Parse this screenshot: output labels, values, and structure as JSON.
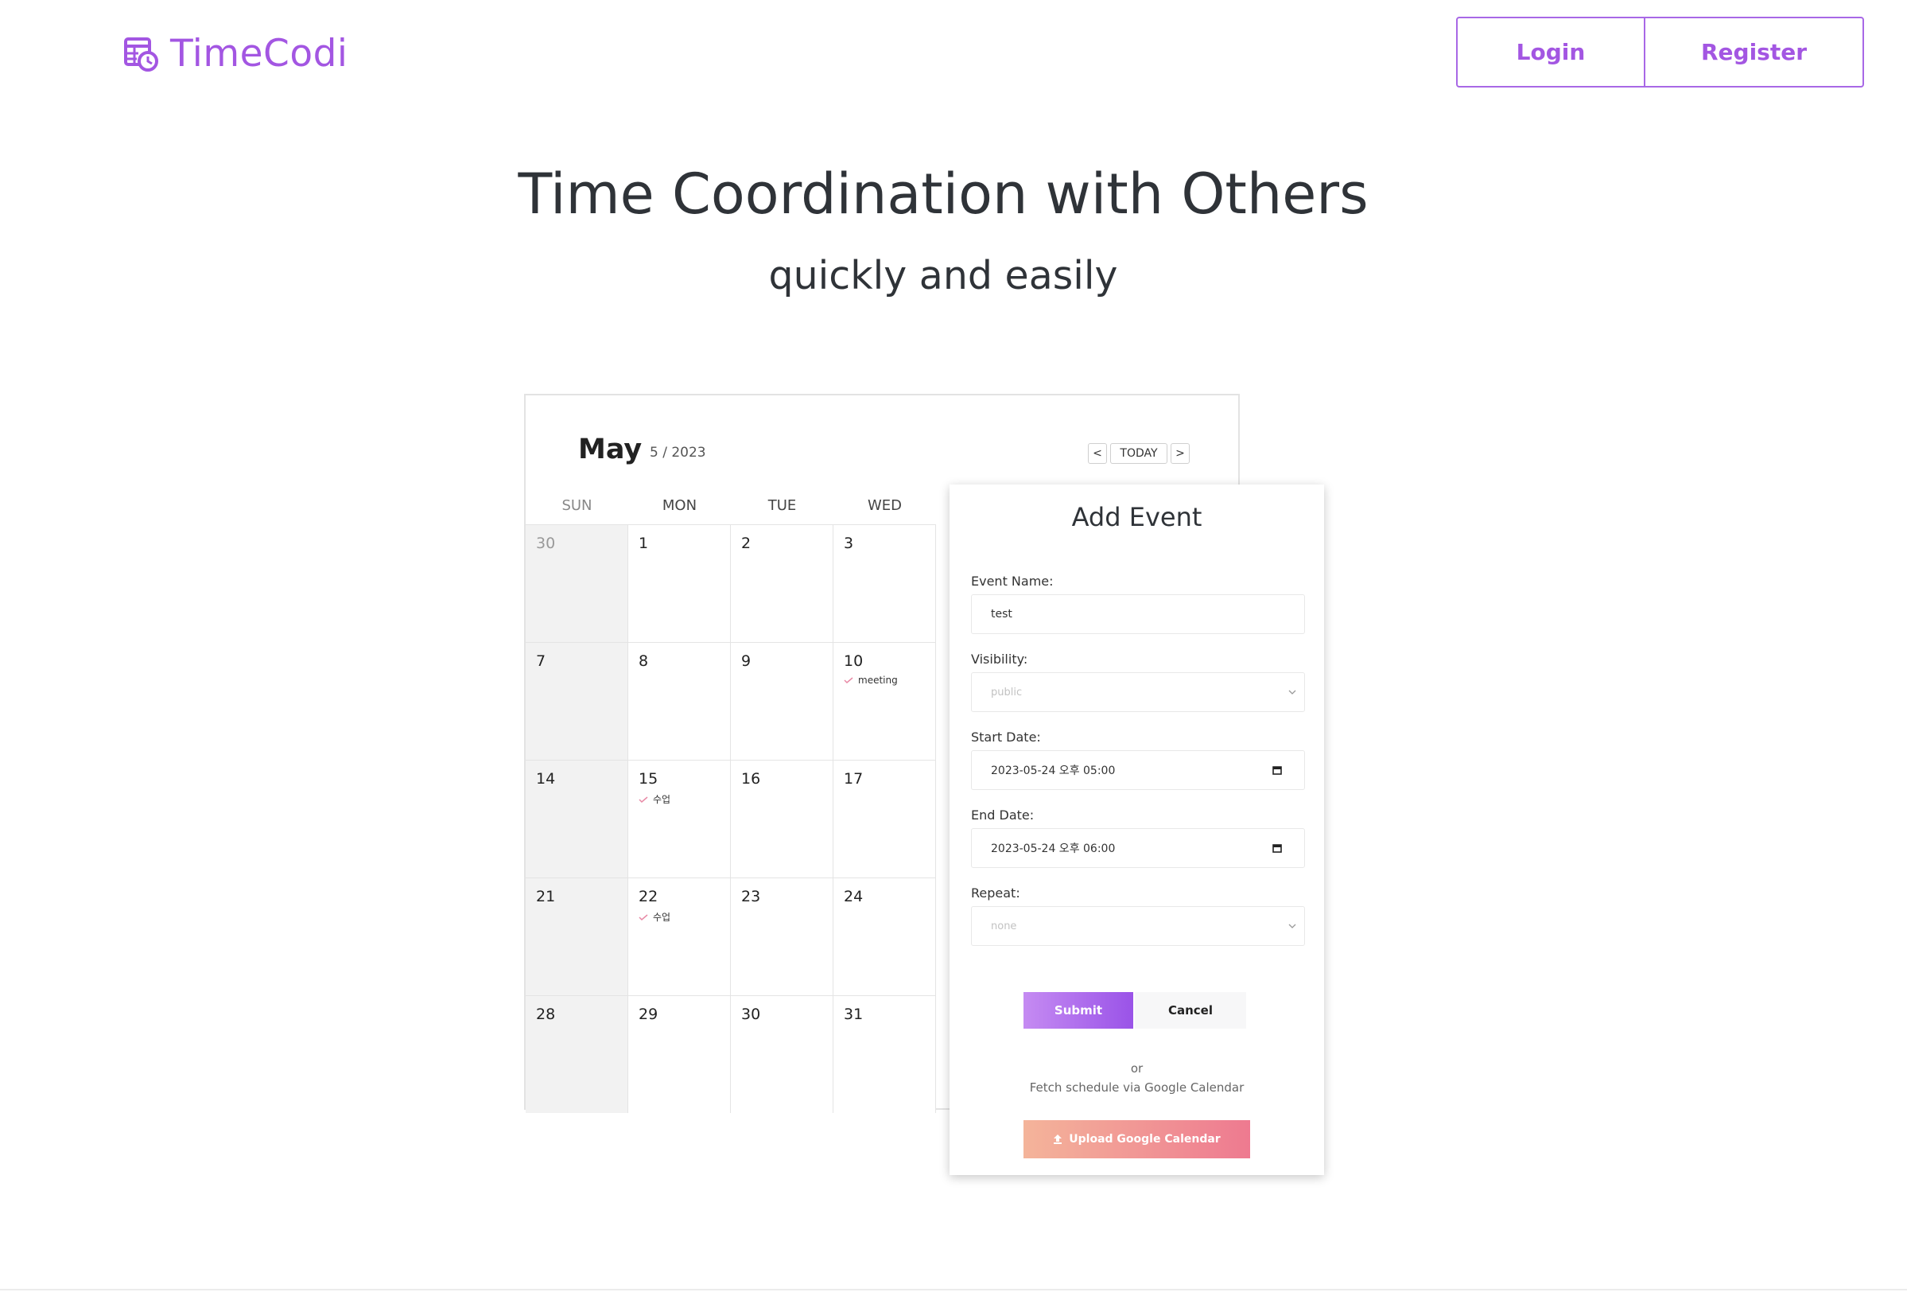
{
  "header": {
    "brand": "TimeCodi",
    "login_label": "Login",
    "register_label": "Register"
  },
  "hero": {
    "title": "Time Coordination with Others",
    "subtitle": "quickly and easily"
  },
  "calendar": {
    "month": "May",
    "sub": "5 / 2023",
    "prev_label": "<",
    "today_label": "TODAY",
    "next_label": ">",
    "weekdays": [
      "SUN",
      "MON",
      "TUE",
      "WED"
    ],
    "weeks": [
      [
        "30",
        "1",
        "2",
        "3"
      ],
      [
        "7",
        "8",
        "9",
        "10"
      ],
      [
        "14",
        "15",
        "16",
        "17"
      ],
      [
        "21",
        "22",
        "23",
        "24"
      ],
      [
        "28",
        "29",
        "30",
        "31"
      ]
    ],
    "events": [
      {
        "week": 1,
        "day": 3,
        "label": "meeting"
      },
      {
        "week": 2,
        "day": 1,
        "label": "수업"
      },
      {
        "week": 3,
        "day": 1,
        "label": "수업"
      }
    ]
  },
  "modal": {
    "title": "Add Event",
    "event_name_label": "Event Name:",
    "event_name_value": "test",
    "visibility_label": "Visibility:",
    "visibility_value": "public",
    "start_label": "Start Date:",
    "start_value": "2023-05-24 오후 05:00",
    "end_label": "End Date:",
    "end_value": "2023-05-24 오후 06:00",
    "repeat_label": "Repeat:",
    "repeat_value": "none",
    "submit_label": "Submit",
    "cancel_label": "Cancel",
    "or_text": "or",
    "fetch_text": "Fetch schedule via Google Calendar",
    "upload_label": "Upload Google Calendar"
  },
  "colors": {
    "brand": "#a356e2",
    "event_tick": "#e88aa6"
  }
}
